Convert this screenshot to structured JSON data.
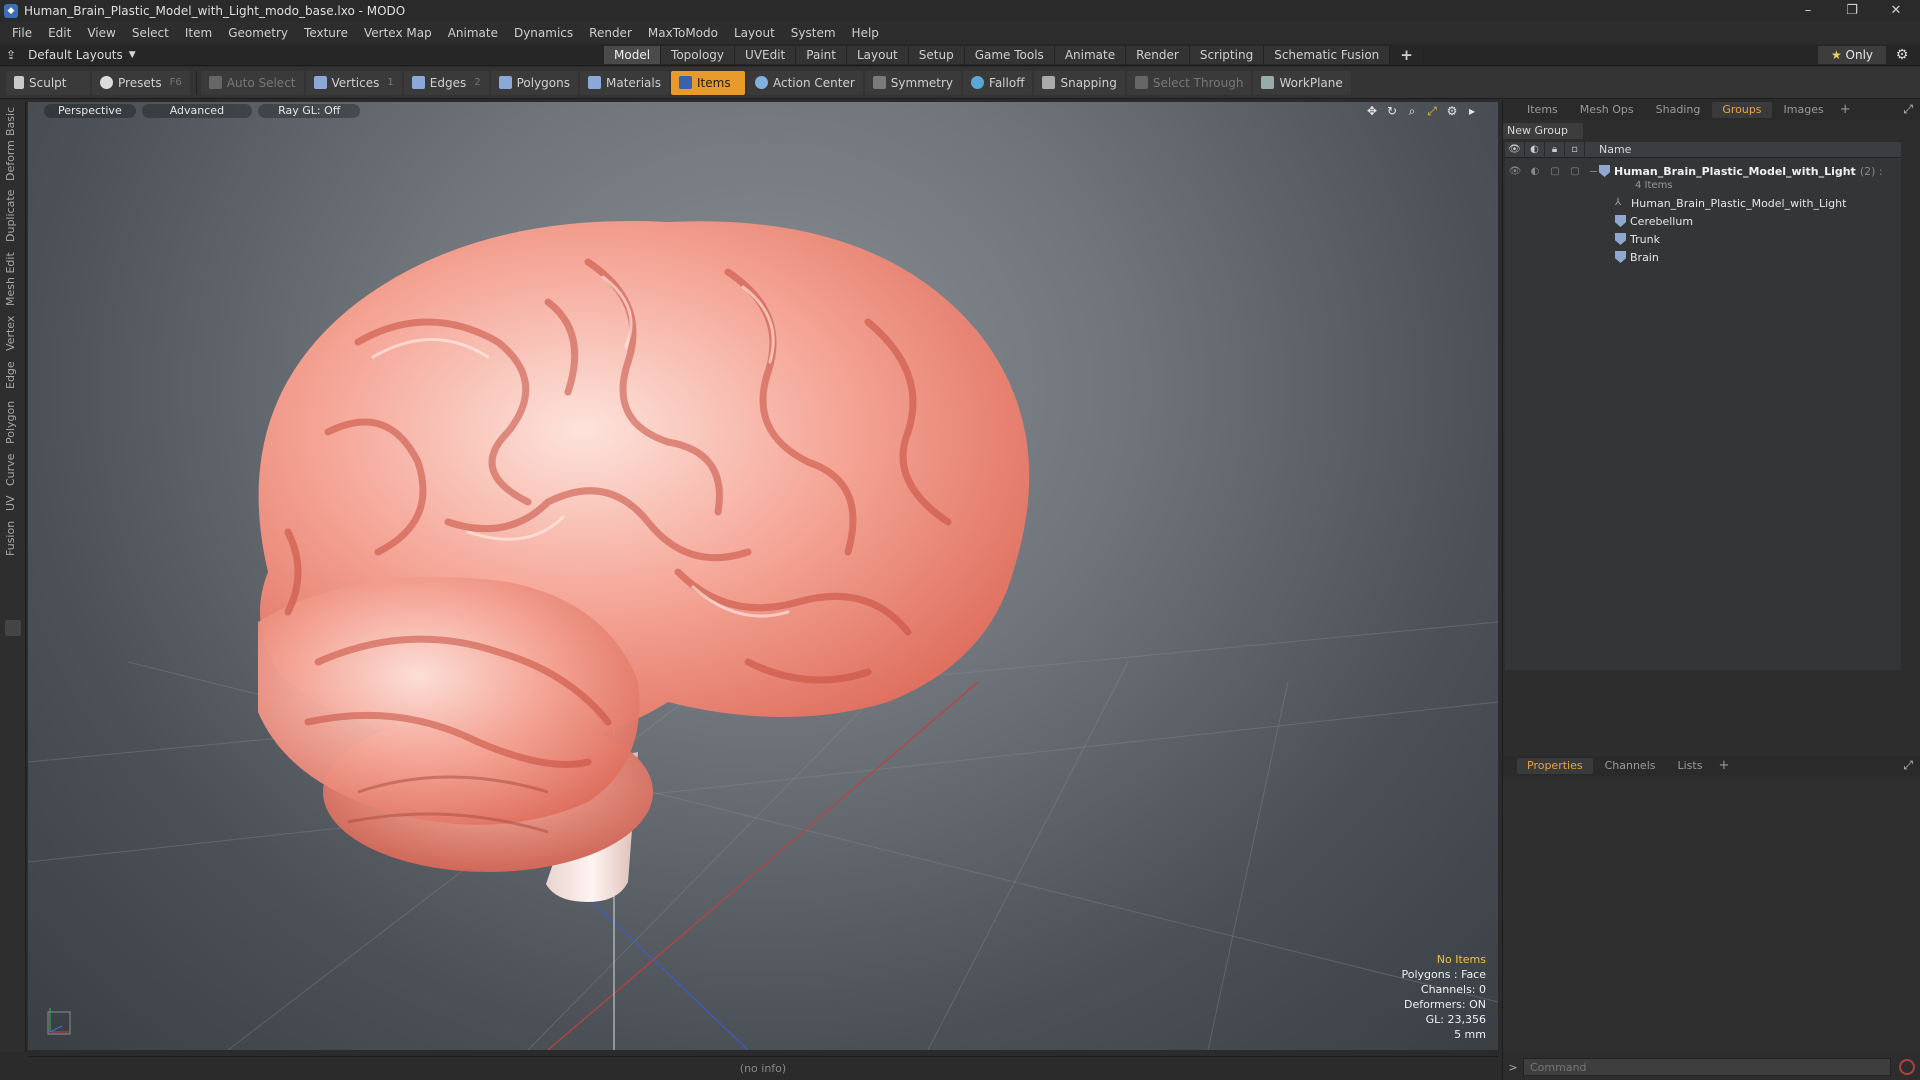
{
  "window": {
    "title": "Human_Brain_Plastic_Model_with_Light_modo_base.lxo - MODO",
    "controls": [
      "–",
      "❐",
      "✕"
    ]
  },
  "menu": [
    "File",
    "Edit",
    "View",
    "Select",
    "Item",
    "Geometry",
    "Texture",
    "Vertex Map",
    "Animate",
    "Dynamics",
    "Render",
    "MaxToModo",
    "Layout",
    "System",
    "Help"
  ],
  "layoutbar": {
    "layouts_label": "Default Layouts",
    "tabs": [
      "Model",
      "Topology",
      "UVEdit",
      "Paint",
      "Layout",
      "Setup",
      "Game Tools",
      "Animate",
      "Render",
      "Scripting",
      "Schematic Fusion"
    ],
    "active_tab": "Model",
    "add_tab": "+",
    "only_star": "★",
    "only_label": "Only"
  },
  "toolbar": {
    "sculpt": "Sculpt",
    "presets": "Presets",
    "presets_key": "F6",
    "auto_select": "Auto Select",
    "vertices": "Vertices",
    "vertices_key": "1",
    "edges": "Edges",
    "edges_key": "2",
    "polygons": "Polygons",
    "materials": "Materials",
    "items": "Items",
    "action_center": "Action Center",
    "symmetry": "Symmetry",
    "falloff": "Falloff",
    "snapping": "Snapping",
    "select_through": "Select Through",
    "workplane": "WorkPlane"
  },
  "left_tabs": [
    "Basic",
    "Deform",
    "Duplicate",
    "Mesh Edit",
    "Vertex",
    "Edge",
    "Polygon",
    "Curve",
    "UV",
    "Fusion"
  ],
  "viewport": {
    "view_mode": "Perspective",
    "shading": "Advanced",
    "raygl": "Ray GL: Off",
    "info": {
      "selection": "No Items",
      "polygons": "Polygons : Face",
      "channels": "Channels: 0",
      "deformers": "Deformers: ON",
      "gl": "GL: 23,356",
      "scale": "5 mm"
    }
  },
  "status": "(no info)",
  "panel_top": {
    "tabs": [
      "Items",
      "Mesh Ops",
      "Shading",
      "Groups",
      "Images"
    ],
    "active_tab": "Groups",
    "add_tab": "+",
    "new_group": "New Group",
    "column_name": "Name",
    "groups": [
      {
        "name": "Human_Brain_Plastic_Model_with_Light",
        "count": "(2) :",
        "items_label": "4 Items",
        "top": true
      },
      {
        "name": "Human_Brain_Plastic_Model_with_Light",
        "kind": "mesh"
      },
      {
        "name": "Cerebellum",
        "kind": "group"
      },
      {
        "name": "Trunk",
        "kind": "group"
      },
      {
        "name": "Brain",
        "kind": "group"
      }
    ]
  },
  "panel_bottom": {
    "tabs": [
      "Properties",
      "Channels",
      "Lists"
    ],
    "active_tab": "Properties",
    "add_tab": "+"
  },
  "command": {
    "prompt": ">",
    "placeholder": "Command"
  },
  "colors": {
    "accent": "#e89a2a",
    "brain": "#f08a7a",
    "viewport_bg": "#6f757b"
  }
}
